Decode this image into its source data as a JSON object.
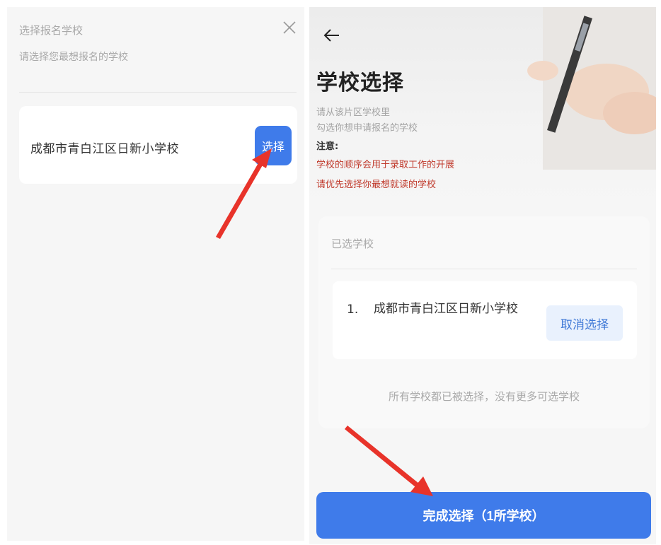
{
  "left_panel": {
    "title": "选择报名学校",
    "subtitle": "请选择您最想报名的学校",
    "close_icon": "close-icon",
    "school": {
      "name": "成都市青白江区日新小学校",
      "select_label": "选择"
    }
  },
  "right_panel": {
    "back_icon": "back-arrow-icon",
    "title": "学校选择",
    "desc_line1": "请从该片区学校里",
    "desc_line2": "勾选你想申请报名的学校",
    "note_label": "注意:",
    "warning_line1": "学校的顺序会用于录取工作的开展",
    "warning_line2": "请优先选择你最想就读的学校",
    "selected_section": {
      "label": "已选学校",
      "items": [
        {
          "index": "1.",
          "name": "成都市青白江区日新小学校",
          "cancel_label": "取消选择"
        }
      ],
      "footer_message": "所有学校都已被选择，没有更多可选学校"
    },
    "finish_button_label": "完成选择（1所学校）"
  },
  "colors": {
    "primary_blue": "#3f7bea",
    "warning_red": "#c0392b",
    "annotation_red": "#e8332a"
  }
}
